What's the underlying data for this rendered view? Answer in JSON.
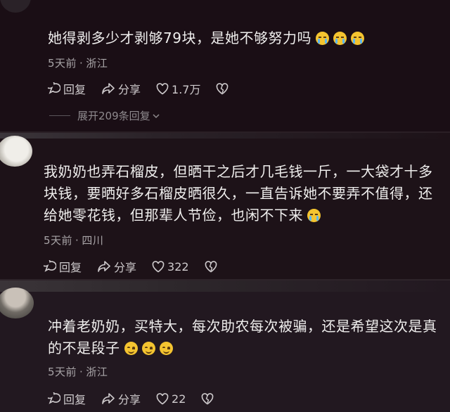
{
  "comments": [
    {
      "text": "她得剥多少才剥够79块，是她不够努力吗",
      "emojis": [
        "crying-face",
        "crying-face",
        "crying-face"
      ],
      "time": "5天前",
      "location": "浙江",
      "reply_label": "回复",
      "share_label": "分享",
      "likes": "1.7万",
      "expand_label": "展开209条回复"
    },
    {
      "text": "我奶奶也弄石榴皮，但晒干之后才几毛钱一斤，一大袋才十多块钱，要晒好多石榴皮晒很久，一直告诉她不要弄不值得，还给她零花钱，但那辈人节俭，也闲不下来",
      "emojis": [
        "crying-face"
      ],
      "time": "5天前",
      "location": "四川",
      "reply_label": "回复",
      "share_label": "分享",
      "likes": "322"
    },
    {
      "text": "冲着老奶奶，买特大，每次助农每次被骗，还是希望这次是真的不是段子",
      "emojis": [
        "smiling-face",
        "smiling-face",
        "smiling-face"
      ],
      "time": "5天前",
      "location": "浙江",
      "reply_label": "回复",
      "share_label": "分享",
      "likes": "22"
    }
  ],
  "colors": {
    "background": "#170e14",
    "text": "#efeeed",
    "meta": "#a8a4a7",
    "emoji": "#f4c430"
  }
}
